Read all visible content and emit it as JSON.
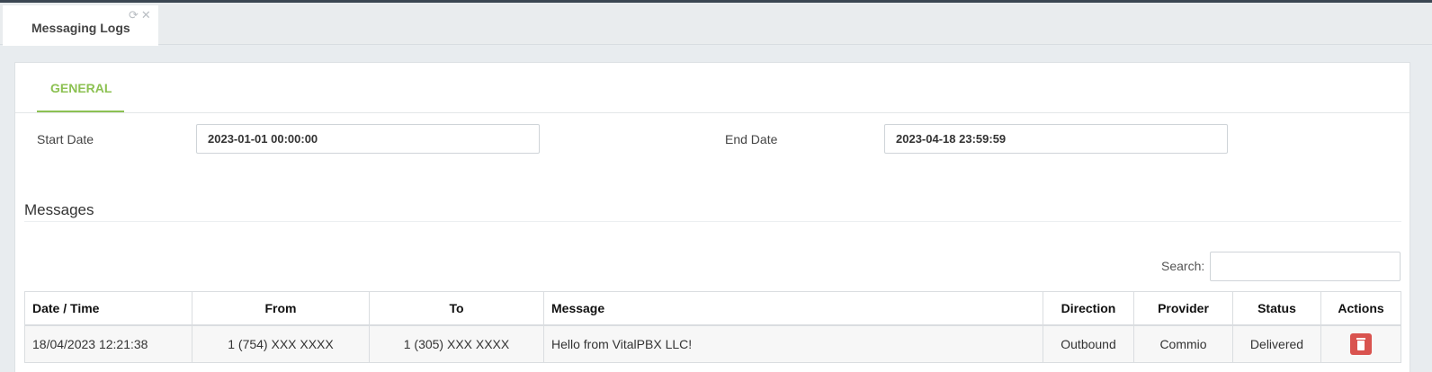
{
  "app_tab": {
    "title": "Messaging Logs",
    "refresh_icon": "refresh-icon",
    "close_icon": "close-icon"
  },
  "section_tab": {
    "label": "GENERAL"
  },
  "filters": {
    "start_date_label": "Start Date",
    "start_date_value": "2023-01-01 00:00:00",
    "end_date_label": "End Date",
    "end_date_value": "2023-04-18 23:59:59"
  },
  "messages": {
    "heading": "Messages",
    "search_label": "Search:",
    "search_value": "",
    "columns": [
      "Date / Time",
      "From",
      "To",
      "Message",
      "Direction",
      "Provider",
      "Status",
      "Actions"
    ],
    "rows": [
      {
        "datetime": "18/04/2023 12:21:38",
        "from": "1 (754) XXX XXXX",
        "to": "1 (305) XXX XXXX",
        "message": "Hello from VitalPBX LLC!",
        "direction": "Outbound",
        "provider": "Commio",
        "status": "Delivered",
        "action_icon": "trash-icon"
      }
    ]
  },
  "colors": {
    "accent": "#8cc152",
    "danger": "#d9534f",
    "header_bar": "#3b4652"
  }
}
